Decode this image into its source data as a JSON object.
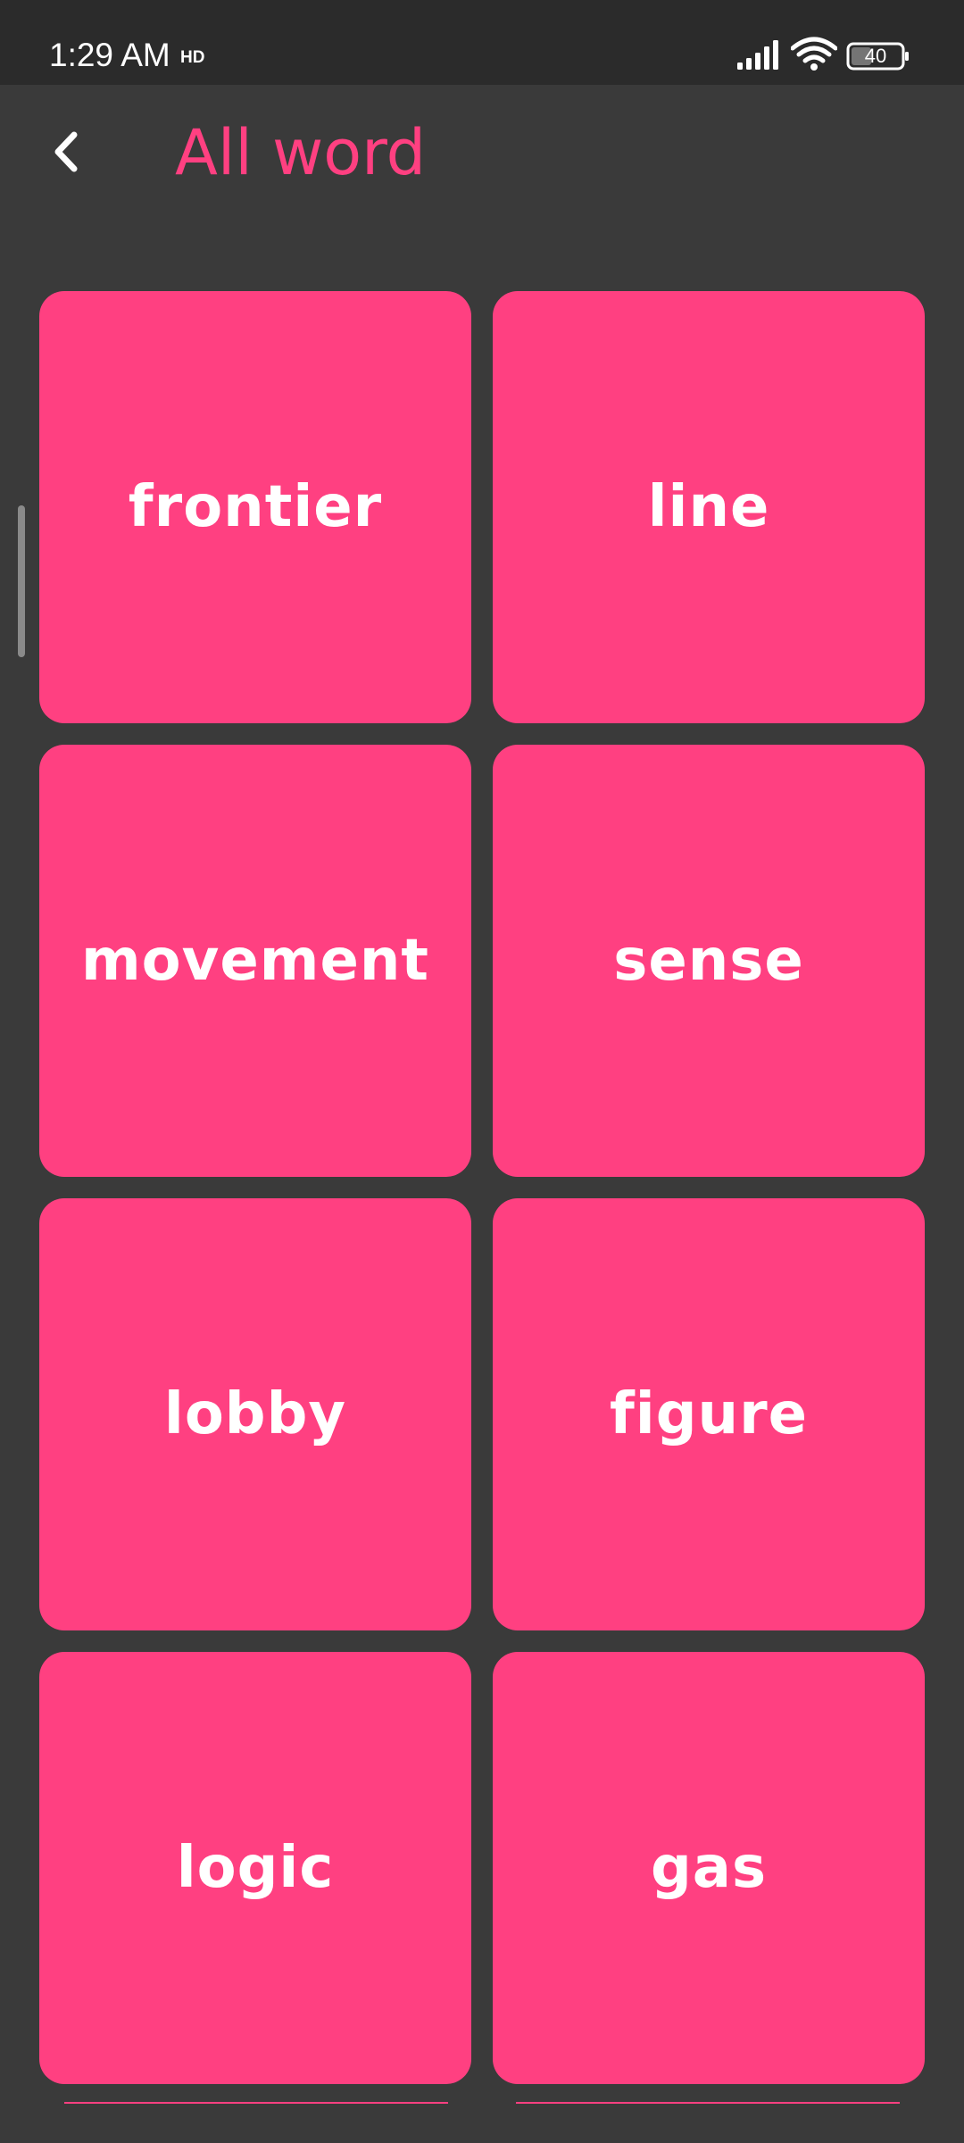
{
  "status_bar": {
    "time": "1:29 AM",
    "hd_badge": "HD",
    "battery_level": "40",
    "icons": [
      "hd-icon",
      "signal-icon",
      "wifi-icon",
      "battery-icon"
    ]
  },
  "header": {
    "back_icon": "chevron-left-icon",
    "title": "All word"
  },
  "words": [
    {
      "label": "frontier"
    },
    {
      "label": "line"
    },
    {
      "label": "movement"
    },
    {
      "label": "sense"
    },
    {
      "label": "lobby"
    },
    {
      "label": "figure"
    },
    {
      "label": "logic"
    },
    {
      "label": "gas"
    }
  ],
  "colors": {
    "accent": "#ff4081",
    "background": "#3a3a3a",
    "status_bar": "#2b2b2b",
    "card_text": "#ffffff"
  }
}
